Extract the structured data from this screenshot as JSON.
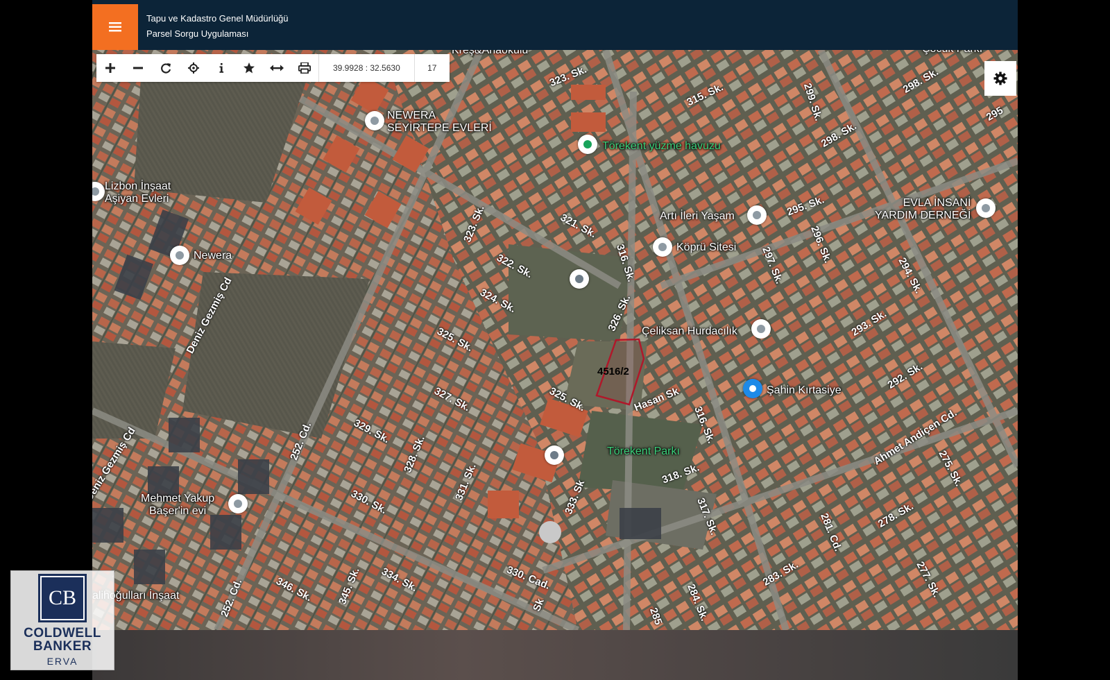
{
  "header": {
    "title_line1": "Tapu ve Kadastro Genel Müdürlüğü",
    "title_line2": "Parsel Sorgu Uygulaması",
    "menu_icon": "hamburger-icon",
    "brand_color": "#f36f21",
    "bar_color": "#0c2438"
  },
  "toolbar": {
    "buttons": [
      {
        "icon": "zoom-in-icon"
      },
      {
        "icon": "zoom-out-icon"
      },
      {
        "icon": "refresh-icon"
      },
      {
        "icon": "locate-icon"
      },
      {
        "icon": "info-icon"
      },
      {
        "icon": "star-icon"
      },
      {
        "icon": "measure-icon"
      },
      {
        "icon": "print-icon"
      }
    ],
    "coordinates": "39.9928 : 32.5630",
    "zoom_level": "17"
  },
  "settings": {
    "icon": "gear-icon"
  },
  "parcel": {
    "label": "4516/2",
    "outline_color": "#b0182a"
  },
  "pois": [
    {
      "name": "Kreş&Anaokulu"
    },
    {
      "name": "NEWERA\nSEYİRTEPE EVLERİ"
    },
    {
      "name": "Törekent yüzme havuzu"
    },
    {
      "name": "Lizbon İnşaat\nAşiyan Evleri"
    },
    {
      "name": "Newera"
    },
    {
      "name": "Artı İleri Yaşam"
    },
    {
      "name": "Köprü Sitesi"
    },
    {
      "name": "EVLA İNSANİ\nYARDIM DERNEĞİ"
    },
    {
      "name": "Çeliksan Hurdacılık"
    },
    {
      "name": "Şahin Kırtasiye"
    },
    {
      "name": "Törekent Parkı"
    },
    {
      "name": "Mehmet Yakup\nBaşer'in evi"
    },
    {
      "name": "alihoğulları İnşaat"
    },
    {
      "name": "Çocuk Parkı"
    }
  ],
  "streets": [
    "323. Sk.",
    "315. Sk.",
    "299. Sk.",
    "298. Sk.",
    "298. Sk.",
    "295. Sk.",
    "295",
    "321. Sk.",
    "322. Sk.",
    "323. Sk.",
    "316. Sk.",
    "297. Sk.",
    "296. Sk.",
    "294. Sk.",
    "324. Sk.",
    "326. Sk.",
    "325. Sk.",
    "293. Sk.",
    "325. Sk.",
    "Hasan Sk",
    "292. Sk.",
    "327. Sk.",
    "316. Sk.",
    "Ahmet Andiçen Cd.",
    "329. Sk.",
    "328. Sk.",
    "252. Cd.",
    "275. Sk.",
    "331. Sk.",
    "333. Sk",
    "318. Sk.",
    "317. Sk.",
    "281. Cd.",
    "278. Sk.",
    "330. Sk.",
    "330. Cad.",
    "334. Sk.",
    "346. Sk.",
    "345. Sk.",
    "284. Sk.",
    "283. Sk.",
    "277. Sk.",
    "252. Cd.",
    "285",
    "Sk",
    "Deniz Gezmiş Cd",
    "Deniz Gezmiş Cd"
  ],
  "logo": {
    "monogram": "CB",
    "line1": "COLDWELL",
    "line2": "BANKER",
    "line3": "ERVA"
  }
}
